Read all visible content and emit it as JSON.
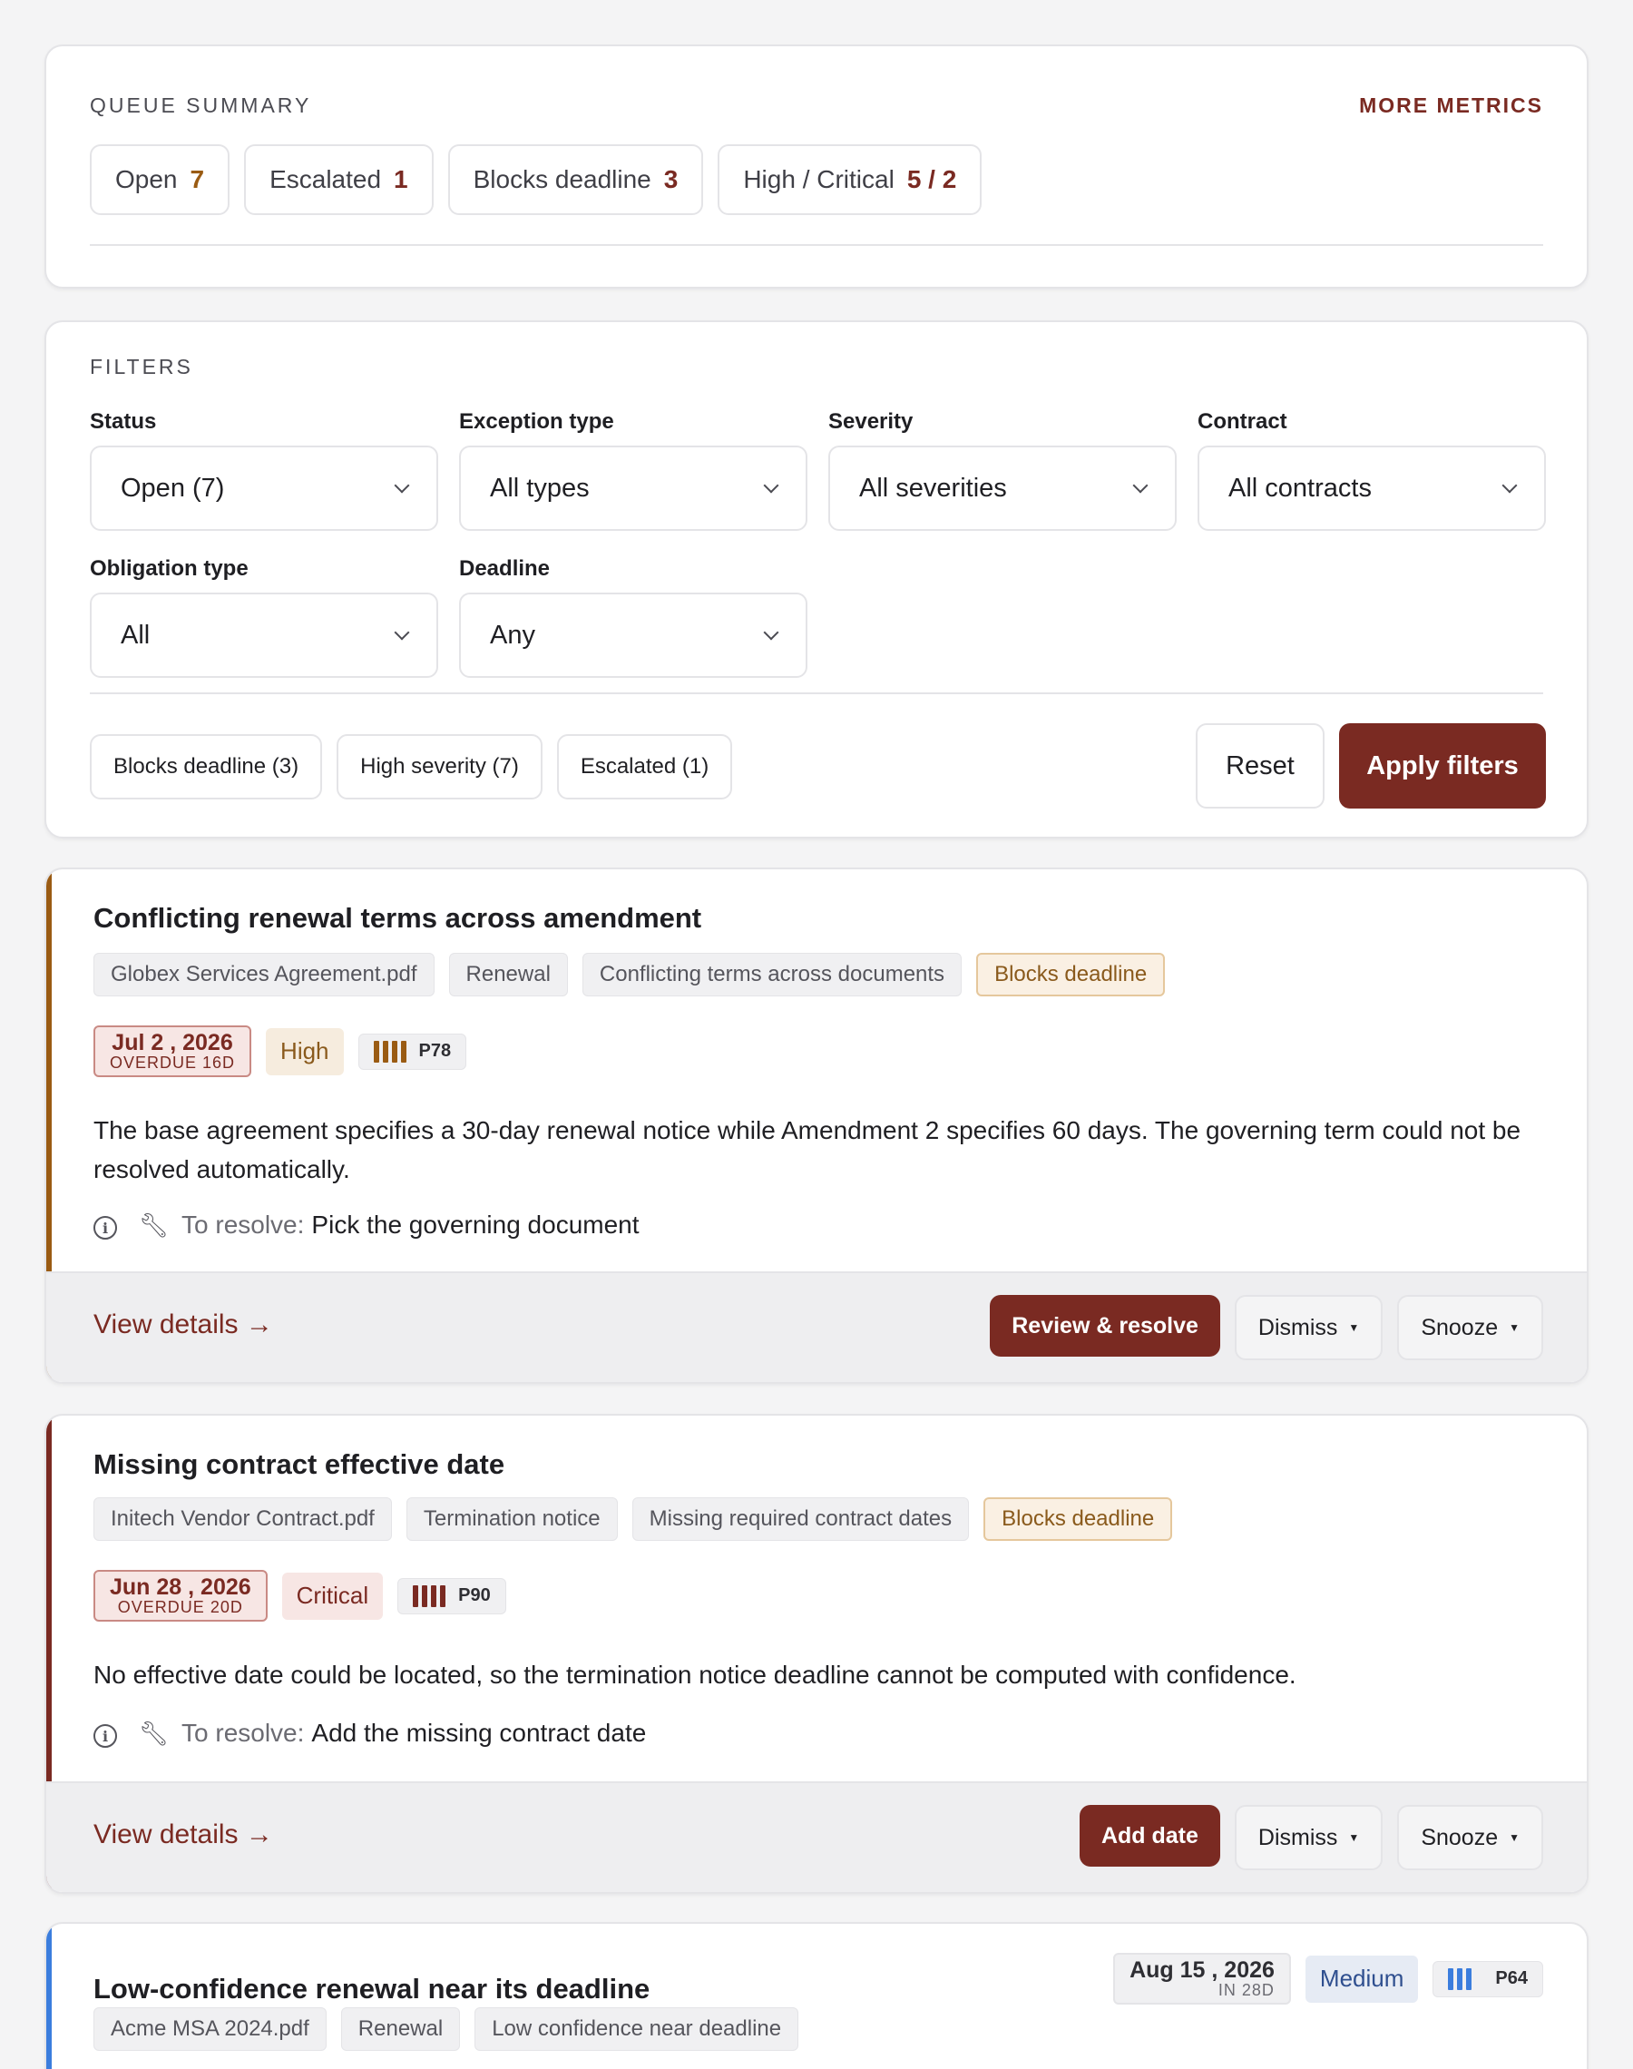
{
  "summary": {
    "label": "QUEUE SUMMARY",
    "more_metrics": "MORE METRICS",
    "stats": [
      {
        "label": "Open",
        "value": "7"
      },
      {
        "label": "Escalated",
        "value": "1"
      },
      {
        "label": "Blocks deadline",
        "value": "3"
      },
      {
        "label": "High / Critical",
        "value": "5 / 2"
      }
    ]
  },
  "filters": {
    "label": "FILTERS",
    "fields": [
      {
        "label": "Status",
        "value": "Open (7)"
      },
      {
        "label": "Exception type",
        "value": "All types"
      },
      {
        "label": "Severity",
        "value": "All severities"
      },
      {
        "label": "Contract",
        "value": "All contracts"
      },
      {
        "label": "Obligation type",
        "value": "All"
      },
      {
        "label": "Deadline",
        "value": "Any"
      }
    ],
    "quick": [
      "Blocks deadline (3)",
      "High severity (7)",
      "Escalated (1)"
    ],
    "reset": "Reset",
    "apply": "Apply filters"
  },
  "exceptions": [
    {
      "title": "Conflicting renewal terms across amendment",
      "tags": [
        "Globex Services Agreement.pdf",
        "Renewal",
        "Conflicting terms across documents"
      ],
      "flag": "Blocks deadline",
      "date": "Jul 2 , 2026",
      "date_status": "OVERDUE 16D",
      "severity": "High",
      "priority": "P78",
      "priority_color": "#7a2a22",
      "accent": "#9a5b13",
      "description": "The base agreement specifies a 30-day renewal notice while Amendment 2 specifies 60 days. The governing term could not be resolved automatically.",
      "resolve_label": "To resolve:",
      "resolve_text": "Pick the governing document",
      "view": "View details →",
      "primary": "Review & resolve",
      "dismiss": "Dismiss",
      "snooze": "Snooze"
    },
    {
      "title": "Missing contract effective date",
      "tags": [
        "Initech Vendor Contract.pdf",
        "Termination notice",
        "Missing required contract dates"
      ],
      "flag": "Blocks deadline",
      "date": "Jun 28 , 2026",
      "date_status": "OVERDUE 20D",
      "severity": "Critical",
      "priority": "P90",
      "priority_color": "#7a2a22",
      "accent": "#7a2a22",
      "description": "No effective date could be located, so the termination notice deadline cannot be computed with confidence.",
      "resolve_label": "To resolve:",
      "resolve_text": "Add the missing contract date",
      "view": "View details →",
      "primary": "Add date",
      "dismiss": "Dismiss",
      "snooze": "Snooze"
    },
    {
      "title": "Low-confidence renewal near its deadline",
      "tags": [
        "Acme MSA 2024.pdf",
        "Renewal",
        "Low confidence near deadline"
      ],
      "date": "Aug 15 , 2026",
      "date_status": "IN 28D",
      "severity": "Medium",
      "priority": "P64",
      "priority_color": "#3b7ddd",
      "accent": "#3b7ddd"
    }
  ]
}
